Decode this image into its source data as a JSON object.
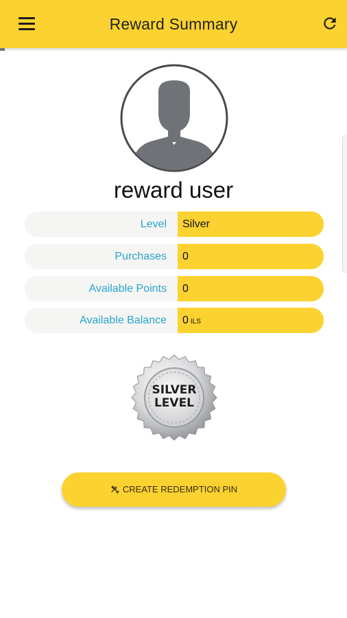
{
  "header": {
    "title": "Reward Summary",
    "menu_icon": "hamburger-menu-icon",
    "refresh_icon": "refresh-icon",
    "background": "#fbd230"
  },
  "profile": {
    "avatar_icon": "default-user-avatar-icon",
    "name": "reward user"
  },
  "summary": {
    "rows": [
      {
        "label": "Level",
        "value": "Silver",
        "unit": ""
      },
      {
        "label": "Purchases",
        "value": "0",
        "unit": ""
      },
      {
        "label": "Available Points",
        "value": "0",
        "unit": ""
      },
      {
        "label": "Available Balance",
        "value": "0",
        "unit": "ILS"
      }
    ],
    "label_color": "#2aa4cf",
    "value_bg": "#fbd230"
  },
  "level_badge": {
    "line1": "SILVER",
    "line2": "LEVEL"
  },
  "actions": {
    "create_pin_label": "CREATE REDEMPTION PIN",
    "create_pin_icon": "tools-icon"
  }
}
